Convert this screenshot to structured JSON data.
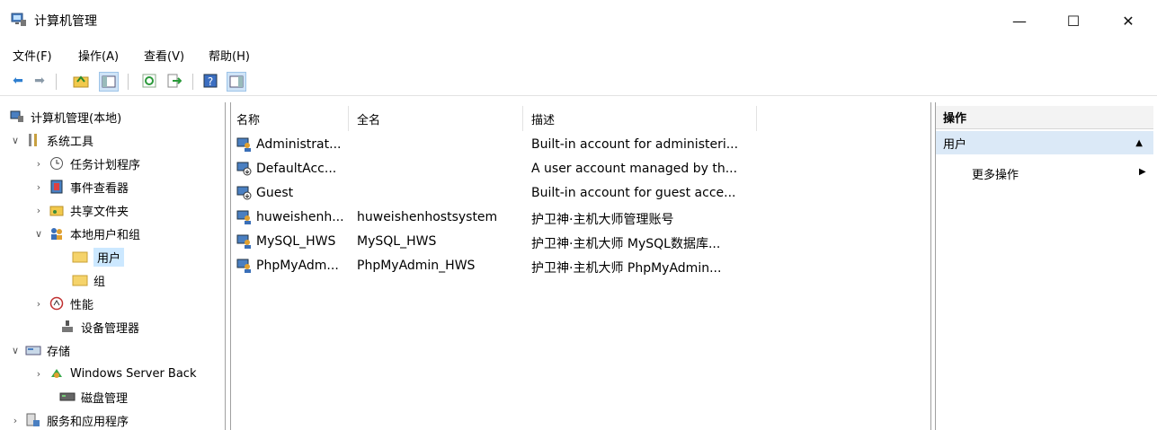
{
  "window": {
    "title": "计算机管理",
    "controls": {
      "minimize": "—",
      "maximize": "☐",
      "close": "✕"
    }
  },
  "menu": {
    "items": [
      "文件(F)",
      "操作(A)",
      "查看(V)",
      "帮助(H)"
    ]
  },
  "tree": [
    {
      "label": "计算机管理(本地)",
      "icon": "computer-management-icon",
      "expand": ""
    },
    {
      "label": "系统工具",
      "icon": "tools-icon",
      "expand": "∨"
    },
    {
      "label": "任务计划程序",
      "icon": "clock-icon",
      "expand": "›"
    },
    {
      "label": "事件查看器",
      "icon": "event-viewer-icon",
      "expand": "›"
    },
    {
      "label": "共享文件夹",
      "icon": "shared-folder-icon",
      "expand": "›"
    },
    {
      "label": "本地用户和组",
      "icon": "users-groups-icon",
      "expand": "∨"
    },
    {
      "label": "用户",
      "icon": "folder-icon",
      "expand": ""
    },
    {
      "label": "组",
      "icon": "folder-icon",
      "expand": ""
    },
    {
      "label": "性能",
      "icon": "performance-icon",
      "expand": "›"
    },
    {
      "label": "设备管理器",
      "icon": "device-manager-icon",
      "expand": ""
    },
    {
      "label": "存储",
      "icon": "storage-icon",
      "expand": "∨"
    },
    {
      "label": "Windows Server Back",
      "icon": "backup-icon",
      "expand": "›"
    },
    {
      "label": "磁盘管理",
      "icon": "disk-icon",
      "expand": ""
    },
    {
      "label": "服务和应用程序",
      "icon": "services-icon",
      "expand": "›"
    }
  ],
  "list": {
    "columns": [
      "名称",
      "全名",
      "描述"
    ],
    "rows": [
      {
        "name": "Administrat...",
        "full": "",
        "desc": "Built-in account for administeri...",
        "disabled": false
      },
      {
        "name": "DefaultAcc...",
        "full": "",
        "desc": "A user account managed by th...",
        "disabled": true
      },
      {
        "name": "Guest",
        "full": "",
        "desc": "Built-in account for guest acce...",
        "disabled": true
      },
      {
        "name": "huweishenh...",
        "full": "huweishenhostsystem",
        "desc": "护卫神·主机大师管理账号",
        "disabled": false
      },
      {
        "name": "MySQL_HWS",
        "full": "MySQL_HWS",
        "desc": "护卫神·主机大师 MySQL数据库...",
        "disabled": false
      },
      {
        "name": "PhpMyAdm...",
        "full": "PhpMyAdmin_HWS",
        "desc": "护卫神·主机大师 PhpMyAdmin...",
        "disabled": false
      }
    ]
  },
  "actions": {
    "header": "操作",
    "section": "用户",
    "more": "更多操作"
  }
}
